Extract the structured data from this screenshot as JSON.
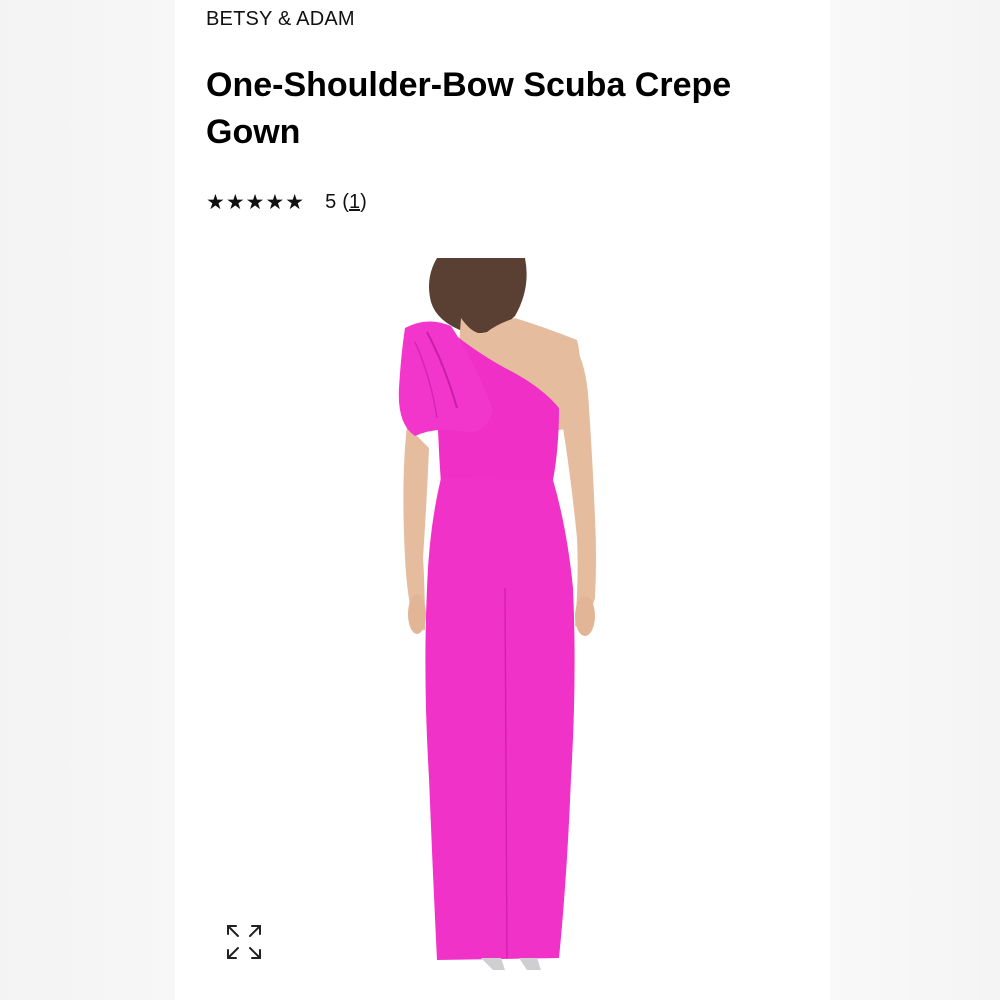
{
  "product": {
    "brand": "BETSY & ADAM",
    "title": "One-Shoulder-Bow Scuba Crepe Gown",
    "rating": {
      "stars_filled": 5,
      "stars_total": 5,
      "stars_text": "★★★★★",
      "value": "5",
      "count_open": "(",
      "count": "1",
      "count_close": ")"
    }
  },
  "image": {
    "description_icon": "expand-icon",
    "dress_color": "#F030C8",
    "skin_color": "#E9C2A6",
    "hair_color": "#5a3f33"
  }
}
